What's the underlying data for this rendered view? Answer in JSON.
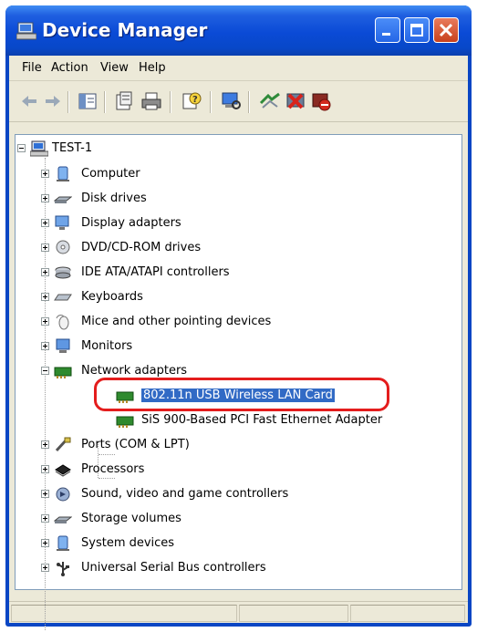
{
  "window": {
    "title": "Device Manager"
  },
  "menu": {
    "items": [
      "File",
      "Action",
      "View",
      "Help"
    ]
  },
  "toolbar": {
    "icons": [
      "back-arrow-icon",
      "forward-arrow-icon",
      "show-hide-console-tree-icon",
      "properties-icon",
      "print-icon",
      "help-icon",
      "scan-hardware-icon",
      "update-driver-icon",
      "uninstall-icon",
      "disable-device-icon"
    ]
  },
  "tree": {
    "root": "TEST-1",
    "categories": {
      "computer": "Computer",
      "disk_drives": "Disk drives",
      "display_adapters": "Display adapters",
      "dvd_cdrom": "DVD/CD-ROM drives",
      "ide_ata": "IDE ATA/ATAPI controllers",
      "keyboards": "Keyboards",
      "mice": "Mice and other pointing devices",
      "monitors": "Monitors",
      "network_adapters": "Network adapters",
      "ports": "Ports (COM & LPT)",
      "processors": "Processors",
      "sound": "Sound, video and game controllers",
      "storage": "Storage volumes",
      "system": "System devices",
      "usb": "Universal Serial Bus controllers"
    },
    "network_children": {
      "wireless": "802.11n USB Wireless LAN Card",
      "ethernet": "SiS 900-Based PCI Fast Ethernet Adapter"
    },
    "selected": "802.11n USB Wireless LAN Card"
  },
  "colors": {
    "title_bar": "#0a4ad6",
    "selection": "#316ac5",
    "highlight_ring": "#e41d1d",
    "window_face": "#ece9d8"
  }
}
